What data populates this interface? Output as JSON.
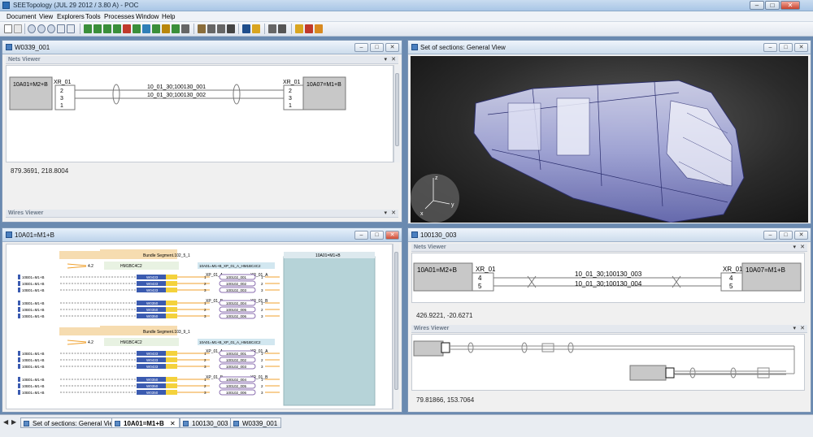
{
  "app": {
    "title": "SEETopology (JUL 29 2012 /   3.80 A) - POC",
    "controls": {
      "minimize": "–",
      "maximize": "□",
      "close": "✕"
    }
  },
  "menu": [
    "Document",
    "View",
    "Explorers",
    "Tools",
    "Processes",
    "Window",
    "Help"
  ],
  "icons": [
    "select-arrow-icon",
    "zoom-icon",
    "zoom-in-icon",
    "zoom-out-icon",
    "fit-all-icon",
    "wire-tool-icon",
    "connector-tool-icon",
    "edit-tool-icon",
    "print-icon",
    "open-icon",
    "folder-icon"
  ],
  "colors": {
    "accent": "#2d6db5",
    "wire": "#f0a02c",
    "bundle": "#3b5bb0",
    "highlight": "#f4d23c",
    "connector_panel": "#b6d3d8"
  },
  "win_w0339": {
    "title": "W0339_001",
    "nets_viewer": "Nets Viewer",
    "wires_viewer": "Wires Viewer",
    "left_box": "10A01=M2+B",
    "left_conn": "XR_01",
    "left_pins": [
      "2",
      "3",
      "1"
    ],
    "right_box": "10A07=M1+B",
    "right_conn": "XR_01",
    "right_pins": [
      "2",
      "3",
      "1"
    ],
    "wire1": "10_01_30;100130_001",
    "wire2": "10_01_30;100130_002",
    "coords": "879.3691, 218.8004",
    "pane_btns": [
      "▾",
      "✕"
    ]
  },
  "win_sections": {
    "title": "Set of sections: General View",
    "axis_x": "x",
    "axis_y": "y",
    "axis_z": "z"
  },
  "win_10a01": {
    "title": "10A01=M1+B",
    "bundle1": "Bundle Segment.102_5_1",
    "bundle2": "Bundle Segment.103_9_1",
    "hm1": "HM1BC4C2",
    "hm2": "HM1BC4C2",
    "cut1": "4.2",
    "cut2": "4.2",
    "conn_header1": "10A01=M1+B_XP_01_A_HM1BC4C2",
    "conn_header2": "10A01=M1+B_XP_01_A_HM1BC4C2",
    "right_header": "10A01=M1+B",
    "xp_a": "XP_01_A",
    "xr_a": "XR_01_A",
    "xp_b": "XP_01_B",
    "xr_b": "XR_01_B",
    "left_labels": [
      "10B01=M1+B",
      "10B01=M1+B",
      "10B01=M1+B",
      "10B01=M1+B",
      "10B01=M1+B",
      "10B01=M1+B"
    ],
    "bundle_tags": [
      "W0433",
      "W0433",
      "W0433",
      "W0350",
      "W0350",
      "W0350"
    ],
    "wires_a": [
      "100102_001",
      "100102_002",
      "100102_003"
    ],
    "wires_b": [
      "100102_004",
      "100102_005",
      "100102_006"
    ],
    "pins": [
      "1",
      "2",
      "3"
    ]
  },
  "win_100130": {
    "title": "100130_003",
    "nets_viewer": "Nets Viewer",
    "wires_viewer": "Wires Viewer",
    "left_box": "10A01=M2+B",
    "left_conn": "XR_01",
    "left_pins": [
      "4",
      "5"
    ],
    "right_box": "10A07=M1+B",
    "right_conn": "XR_01",
    "right_pins": [
      "4",
      "5"
    ],
    "wire1": "10_01_30;100130_003",
    "wire2": "10_01_30;100130_004",
    "coords_nets": "426.9221, -20.6271",
    "coords_wires": "79.81866, 153.7064",
    "pane_btns": [
      "▾",
      "✕"
    ]
  },
  "tabs": [
    {
      "label": "Set of sections: General View",
      "active": false
    },
    {
      "label": "10A01=M1+B",
      "active": true,
      "close": "✕"
    },
    {
      "label": "100130_003",
      "active": false
    },
    {
      "label": "W0339_001",
      "active": false
    }
  ],
  "tab_nav": [
    "◀",
    "▶"
  ]
}
